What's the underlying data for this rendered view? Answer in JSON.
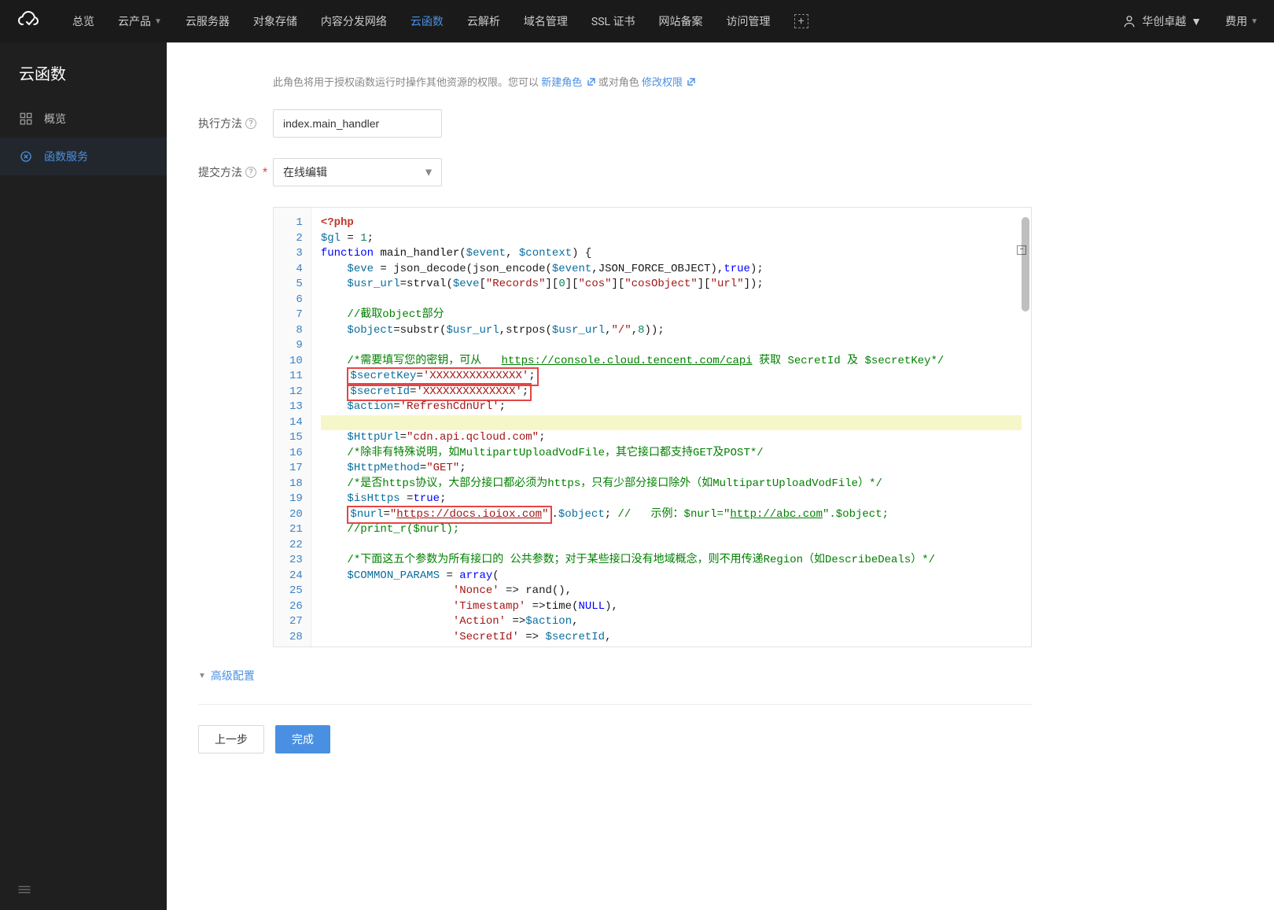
{
  "topbar": {
    "items": [
      "总览",
      "云产品",
      "云服务器",
      "对象存储",
      "内容分发网络",
      "云函数",
      "云解析",
      "域名管理",
      "SSL 证书",
      "网站备案",
      "访问管理"
    ],
    "activeIndex": 5,
    "user": "华创卓越",
    "fee": "费用"
  },
  "sidebar": {
    "title": "云函数",
    "items": [
      {
        "label": "概览",
        "active": false
      },
      {
        "label": "函数服务",
        "active": true
      }
    ]
  },
  "form": {
    "roleHintPrefix": "此角色将用于授权函数运行时操作其他资源的权限。您可以",
    "newRole": "新建角色",
    "or": "或对角色",
    "editPerm": "修改权限",
    "execMethodLabel": "执行方法",
    "execMethodValue": "index.main_handler",
    "submitMethodLabel": "提交方法",
    "submitMethodValue": "在线编辑",
    "advanced": "高级配置",
    "prevBtn": "上一步",
    "doneBtn": "完成"
  },
  "code": {
    "tokens_line10_prefix": "    /*需要填写您的密钥，可从   ",
    "tokens_line10_link": "https://console.cloud.tencent.com/capi",
    "tokens_line10_suffix": " 获取 SecretId 及 $secretKey*/",
    "line20_url": "https://docs.ioiox.com",
    "line20_example_url": "http://abc.com",
    "lineNumbers": [
      1,
      2,
      3,
      4,
      5,
      6,
      7,
      8,
      9,
      10,
      11,
      12,
      13,
      14,
      15,
      16,
      17,
      18,
      19,
      20,
      21,
      22,
      23,
      24,
      25,
      26,
      27,
      28
    ]
  }
}
